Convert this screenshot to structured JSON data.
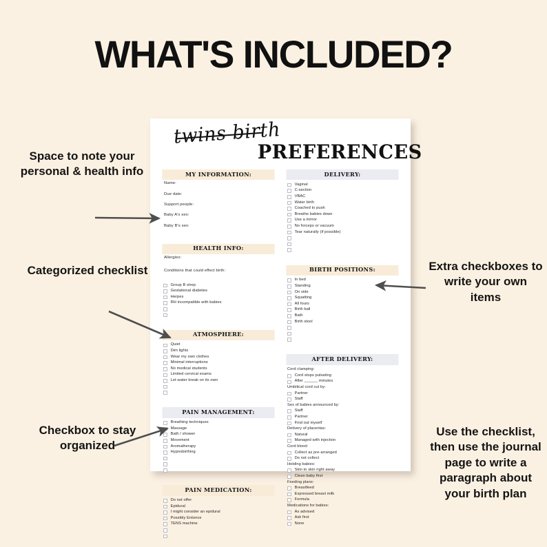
{
  "heading": "WHAT'S INCLUDED?",
  "sheet": {
    "script_title": "twins birth",
    "block_title": "PREFERENCES"
  },
  "colors": {
    "background": "#fbf1e2",
    "sheet": "#ffffff",
    "header_cream": "#f8ecd9",
    "header_lilac": "#ebebf2",
    "checkbox_border": "#b9b9c6",
    "text": "#141414",
    "arrow": "#4e4e4e"
  },
  "left_column": {
    "sections": [
      {
        "title": "MY INFORMATION:",
        "style": "cream",
        "fields": [
          "Name:",
          "Due date:",
          "Support people:",
          "Baby A's sex:",
          "Baby B's sex:"
        ]
      },
      {
        "title": "HEALTH INFO:",
        "style": "cream",
        "fields": [
          "Allergies:",
          "Conditions that could effect birth:"
        ],
        "items": [
          "Group B strep",
          "Gestational diabetes",
          "Herpes",
          "RH incompatible with babies"
        ],
        "blank_boxes": 2
      },
      {
        "title": "ATMOSPHERE:",
        "style": "cream",
        "items": [
          "Quiet",
          "Dim lights",
          "Wear my own clothes",
          "Minimal interruptions",
          "No medical students",
          "Limited cervical exams",
          "Let water break on its own"
        ],
        "blank_boxes": 2
      },
      {
        "title": "PAIN MANAGEMENT:",
        "style": "lilac",
        "items": [
          "Breathing techniques",
          "Massage",
          "Bath / shower",
          "Movement",
          "Aromatherapy",
          "Hypnobirthing"
        ],
        "blank_boxes": 3
      },
      {
        "title": "PAIN MEDICATION:",
        "style": "cream",
        "items": [
          "Do not offer",
          "Epidural",
          "I might consider an epidural",
          "Possibly Entonox",
          "TENS machine"
        ],
        "blank_boxes": 2
      }
    ]
  },
  "right_column": {
    "sections": [
      {
        "title": "DELIVERY:",
        "style": "lilac",
        "items": [
          "Vaginal",
          "C-section",
          "VBAC",
          "Water birth",
          "Coached to push",
          "Breathe babies down",
          "Use a mirror",
          "No forceps or vacuum",
          "Tear naturally (if possible)"
        ],
        "blank_boxes": 3
      },
      {
        "title": "BIRTH POSITIONS:",
        "style": "cream",
        "items": [
          "In bed",
          "Standing",
          "On side",
          "Squatting",
          "All fours",
          "Birth ball",
          "Bath",
          "Birth stool"
        ],
        "blank_boxes": 3
      },
      {
        "title": "AFTER DELIVERY:",
        "style": "lilac",
        "rows": [
          {
            "type": "sub",
            "label": "Cord clamping:"
          },
          {
            "type": "check",
            "label": "Cord stops pulsating"
          },
          {
            "type": "check",
            "label": "After ______ minutes"
          },
          {
            "type": "sub",
            "label": "Umbilical cord cut by:"
          },
          {
            "type": "check",
            "label": "Partner"
          },
          {
            "type": "check",
            "label": "Staff"
          },
          {
            "type": "sub",
            "label": "Sex of babies announced by:"
          },
          {
            "type": "check",
            "label": "Staff"
          },
          {
            "type": "check",
            "label": "Partner"
          },
          {
            "type": "check",
            "label": "Find out myself"
          },
          {
            "type": "sub",
            "label": "Delivery of placentas:"
          },
          {
            "type": "check",
            "label": "Natural"
          },
          {
            "type": "check",
            "label": "Managed with injection"
          },
          {
            "type": "sub",
            "label": "Cord blood:"
          },
          {
            "type": "check",
            "label": "Collect as pre-arranged"
          },
          {
            "type": "check",
            "label": "Do not collect"
          },
          {
            "type": "sub",
            "label": "Holding babies:"
          },
          {
            "type": "check",
            "label": "Skin to skin right away"
          },
          {
            "type": "check",
            "label": "Clean baby first"
          },
          {
            "type": "sub",
            "label": "Feeding plans:"
          },
          {
            "type": "check",
            "label": "Breastfeed"
          },
          {
            "type": "check",
            "label": "Expressed breast milk"
          },
          {
            "type": "check",
            "label": "Formula"
          },
          {
            "type": "sub",
            "label": "Medications for babies:"
          },
          {
            "type": "check",
            "label": "As advised"
          },
          {
            "type": "check",
            "label": "Ask first"
          },
          {
            "type": "check",
            "label": "None"
          }
        ]
      }
    ]
  },
  "annotations": {
    "left_1": "Space to note your personal & health info",
    "left_2": "Categorized checklist",
    "left_3": "Checkbox to stay organized",
    "right_1": "Extra checkboxes to write your own items",
    "right_2": "Use the checklist, then use the journal page to write a paragraph about your birth plan"
  }
}
